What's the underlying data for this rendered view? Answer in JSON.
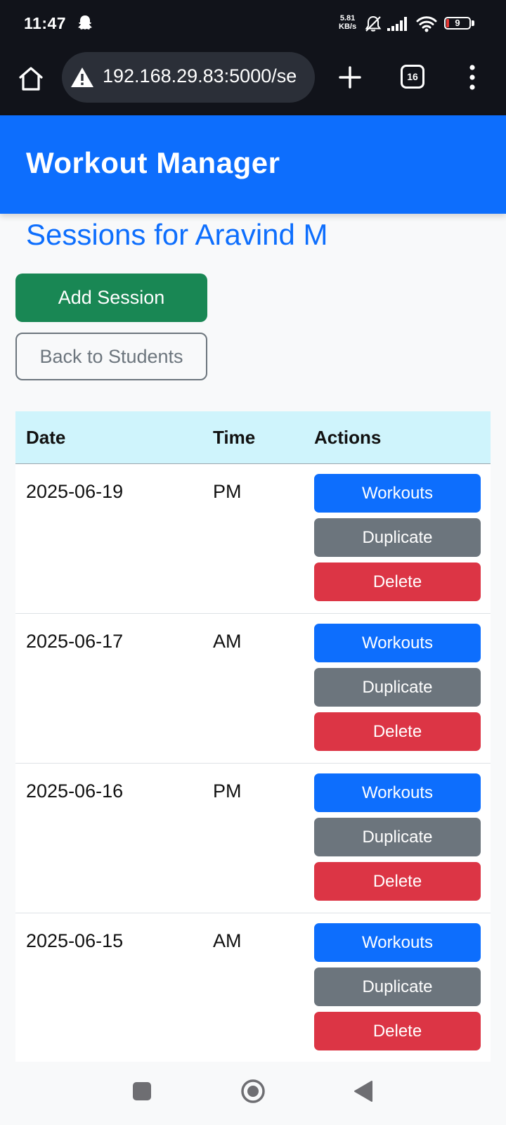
{
  "status_bar": {
    "time": "11:47",
    "net_speed_value": "5.81",
    "net_speed_unit": "KB/s",
    "battery_level": "9",
    "icons": [
      "snapchat-icon",
      "bell-off-icon",
      "signal-icon",
      "wifi-icon",
      "battery-icon"
    ]
  },
  "browser": {
    "url": "192.168.29.83:5000/se",
    "tab_count": "16",
    "icons": [
      "home-icon",
      "warning-icon",
      "plus-icon",
      "tabs-icon",
      "more-vert-icon"
    ]
  },
  "app": {
    "title": "Workout Manager",
    "header_color": "#0d6efd"
  },
  "page": {
    "heading": "Sessions for Aravind M",
    "add_button": "Add Session",
    "back_button": "Back to Students"
  },
  "table": {
    "headers": [
      "Date",
      "Time",
      "Actions"
    ],
    "rows": [
      {
        "date": "2025-06-19",
        "time": "PM",
        "actions": [
          "Workouts",
          "Duplicate",
          "Delete"
        ]
      },
      {
        "date": "2025-06-17",
        "time": "AM",
        "actions": [
          "Workouts",
          "Duplicate",
          "Delete"
        ]
      },
      {
        "date": "2025-06-16",
        "time": "PM",
        "actions": [
          "Workouts",
          "Duplicate",
          "Delete"
        ]
      },
      {
        "date": "2025-06-15",
        "time": "AM",
        "actions": [
          "Workouts",
          "Duplicate",
          "Delete"
        ]
      }
    ]
  },
  "colors": {
    "primary": "#0d6efd",
    "success": "#198754",
    "secondary": "#6c757d",
    "danger": "#dc3545",
    "table_header": "#cff4fc"
  },
  "nav_bar": {
    "icons": [
      "recents-icon",
      "home-circle-icon",
      "back-triangle-icon"
    ]
  }
}
